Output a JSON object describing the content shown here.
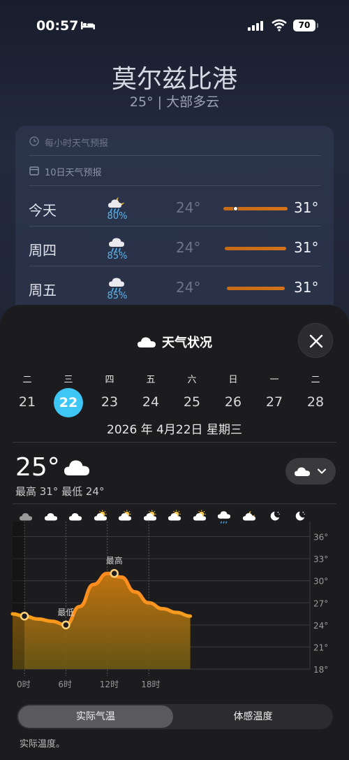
{
  "status": {
    "time": "00:57",
    "battery": "70"
  },
  "header": {
    "city": "莫尔兹比港",
    "summary": "25° | 大部多云"
  },
  "forecast": {
    "hourly_label": "每小时天气预报",
    "tenday_label": "10日天气预报",
    "days": [
      {
        "name": "今天",
        "icon": "moon-cloud-rain-icon",
        "pct": "80%",
        "low": "24°",
        "high": "31°",
        "current_marker": true
      },
      {
        "name": "周四",
        "icon": "cloud-rain-icon",
        "pct": "85%",
        "low": "24°",
        "high": "31°"
      },
      {
        "name": "周五",
        "icon": "cloud-rain-icon",
        "pct": "85%",
        "low": "24°",
        "high": "31°"
      }
    ]
  },
  "sheet": {
    "title": "天气状况",
    "weekdays": [
      "二",
      "三",
      "四",
      "五",
      "六",
      "日",
      "一",
      "二"
    ],
    "dates": [
      "21",
      "22",
      "23",
      "24",
      "25",
      "26",
      "27",
      "28"
    ],
    "selected_index": 1,
    "full_date": "2026 年 4月22日 星期三",
    "current_temp": "25°",
    "hilo": "最高 31° 最低 24°",
    "hourly_icons": [
      "cloud-icon",
      "cloud-icon",
      "cloud-icon",
      "sun-cloud-icon",
      "sun-cloud-icon",
      "sun-cloud-icon",
      "sun-cloud-icon",
      "sun-cloud-icon",
      "cloud-rain-icon",
      "moon-cloud-icon",
      "moon-icon",
      "moon-icon"
    ],
    "segment": {
      "actual": "实际气温",
      "feels": "体感温度"
    },
    "footnote": "实际温度。"
  },
  "chart_data": {
    "type": "area",
    "x_ticks": [
      "0时",
      "6时",
      "12时",
      "18时"
    ],
    "y_ticks": [
      "36°",
      "33°",
      "30°",
      "27°",
      "24°",
      "21°",
      "18°"
    ],
    "ylim": [
      18,
      37
    ],
    "x": [
      -2,
      0,
      2,
      4,
      6,
      8,
      10,
      12,
      14,
      16,
      18,
      20,
      22,
      24
    ],
    "values": [
      25.5,
      25.2,
      24.8,
      24.5,
      24.0,
      26.5,
      29.5,
      31.0,
      30.5,
      28.5,
      27.0,
      26.2,
      25.7,
      25.2
    ],
    "markers": [
      {
        "x": 0,
        "y": 25.2,
        "label": ""
      },
      {
        "x": 6,
        "y": 24.0,
        "label": "最低"
      },
      {
        "x": 13,
        "y": 31.0,
        "label": "最高"
      }
    ]
  }
}
